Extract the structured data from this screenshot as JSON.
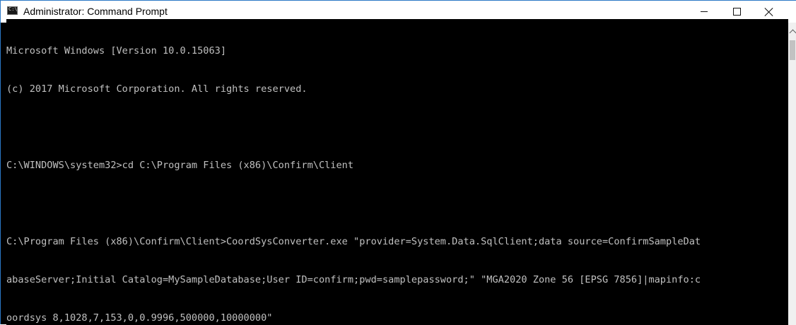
{
  "window": {
    "title": "Administrator: Command Prompt",
    "icon": "cmd-icon",
    "controls": {
      "minimize_icon": "minimize-icon",
      "maximize_icon": "maximize-icon",
      "close_icon": "close-icon"
    }
  },
  "console": {
    "lines": [
      "Microsoft Windows [Version 10.0.15063]",
      "(c) 2017 Microsoft Corporation. All rights reserved.",
      "",
      "C:\\WINDOWS\\system32>cd C:\\Program Files (x86)\\Confirm\\Client",
      "",
      "C:\\Program Files (x86)\\Confirm\\Client>CoordSysConverter.exe \"provider=System.Data.SqlClient;data source=ConfirmSampleDat",
      "abaseServer;Initial Catalog=MySampleDatabase;User ID=confirm;pwd=samplepassword;\" \"MGA2020 Zone 56 [EPSG 7856]|mapinfo:c",
      "oordsys 8,1028,7,153,0,0.9996,500000,10000000\""
    ]
  },
  "colors": {
    "console_background": "#000000",
    "console_text": "#c0c0c0",
    "titlebar_background": "#ffffff",
    "window_border": "#2b78c6"
  }
}
